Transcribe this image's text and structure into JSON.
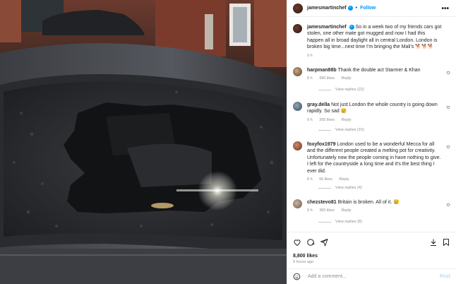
{
  "header": {
    "username": "jamesmartinchef",
    "follow_label": "Follow",
    "separator": "•",
    "more": "•••"
  },
  "caption": {
    "username": "jamesmartinchef",
    "text": "So in a week two of my friends cars got stolen, one other mate got mugged and now I had this happen all in broad daylight all in central London. London is broken big time...next time I'm bringing the Mali's 🐕🐕🐕",
    "time": "9 h"
  },
  "comments": [
    {
      "username": "harpman88b",
      "text": "Thank the double act Starmer & Khan",
      "time": "8 h",
      "likes": "396 likes",
      "reply": "Reply",
      "view_replies": "View replies (22)"
    },
    {
      "username": "gray.della",
      "text": "Not just London the whole country is going down rapidly. So sad 😢",
      "time": "9 h",
      "likes": "265 likes",
      "reply": "Reply",
      "view_replies": "View replies (15)"
    },
    {
      "username": "foxyfox1979",
      "text": "London used to be a wonderful Mecca for all and the different people created a melting pot for creativity. Unfortunately now the people coming in have nothing to give. I left for the countryside a long time and it's the best thing I ever did.",
      "time": "8 h",
      "likes": "56 likes",
      "reply": "Reply",
      "view_replies": "View replies (4)"
    },
    {
      "username": "chezstevo81",
      "text": "Britain is broken. All of it. 😢",
      "time": "9 h",
      "likes": "365 likes",
      "reply": "Reply",
      "view_replies": "View replies (8)"
    }
  ],
  "stats": {
    "likes": "8,800 likes",
    "ago": "9 hours ago"
  },
  "add_comment": {
    "placeholder": "Add a comment...",
    "post_label": "Post"
  },
  "icons": {
    "like": "heart-icon",
    "comment": "comment-icon",
    "share": "share-icon",
    "save": "bookmark-icon",
    "emoji": "emoji-icon",
    "more": "more-icon"
  }
}
